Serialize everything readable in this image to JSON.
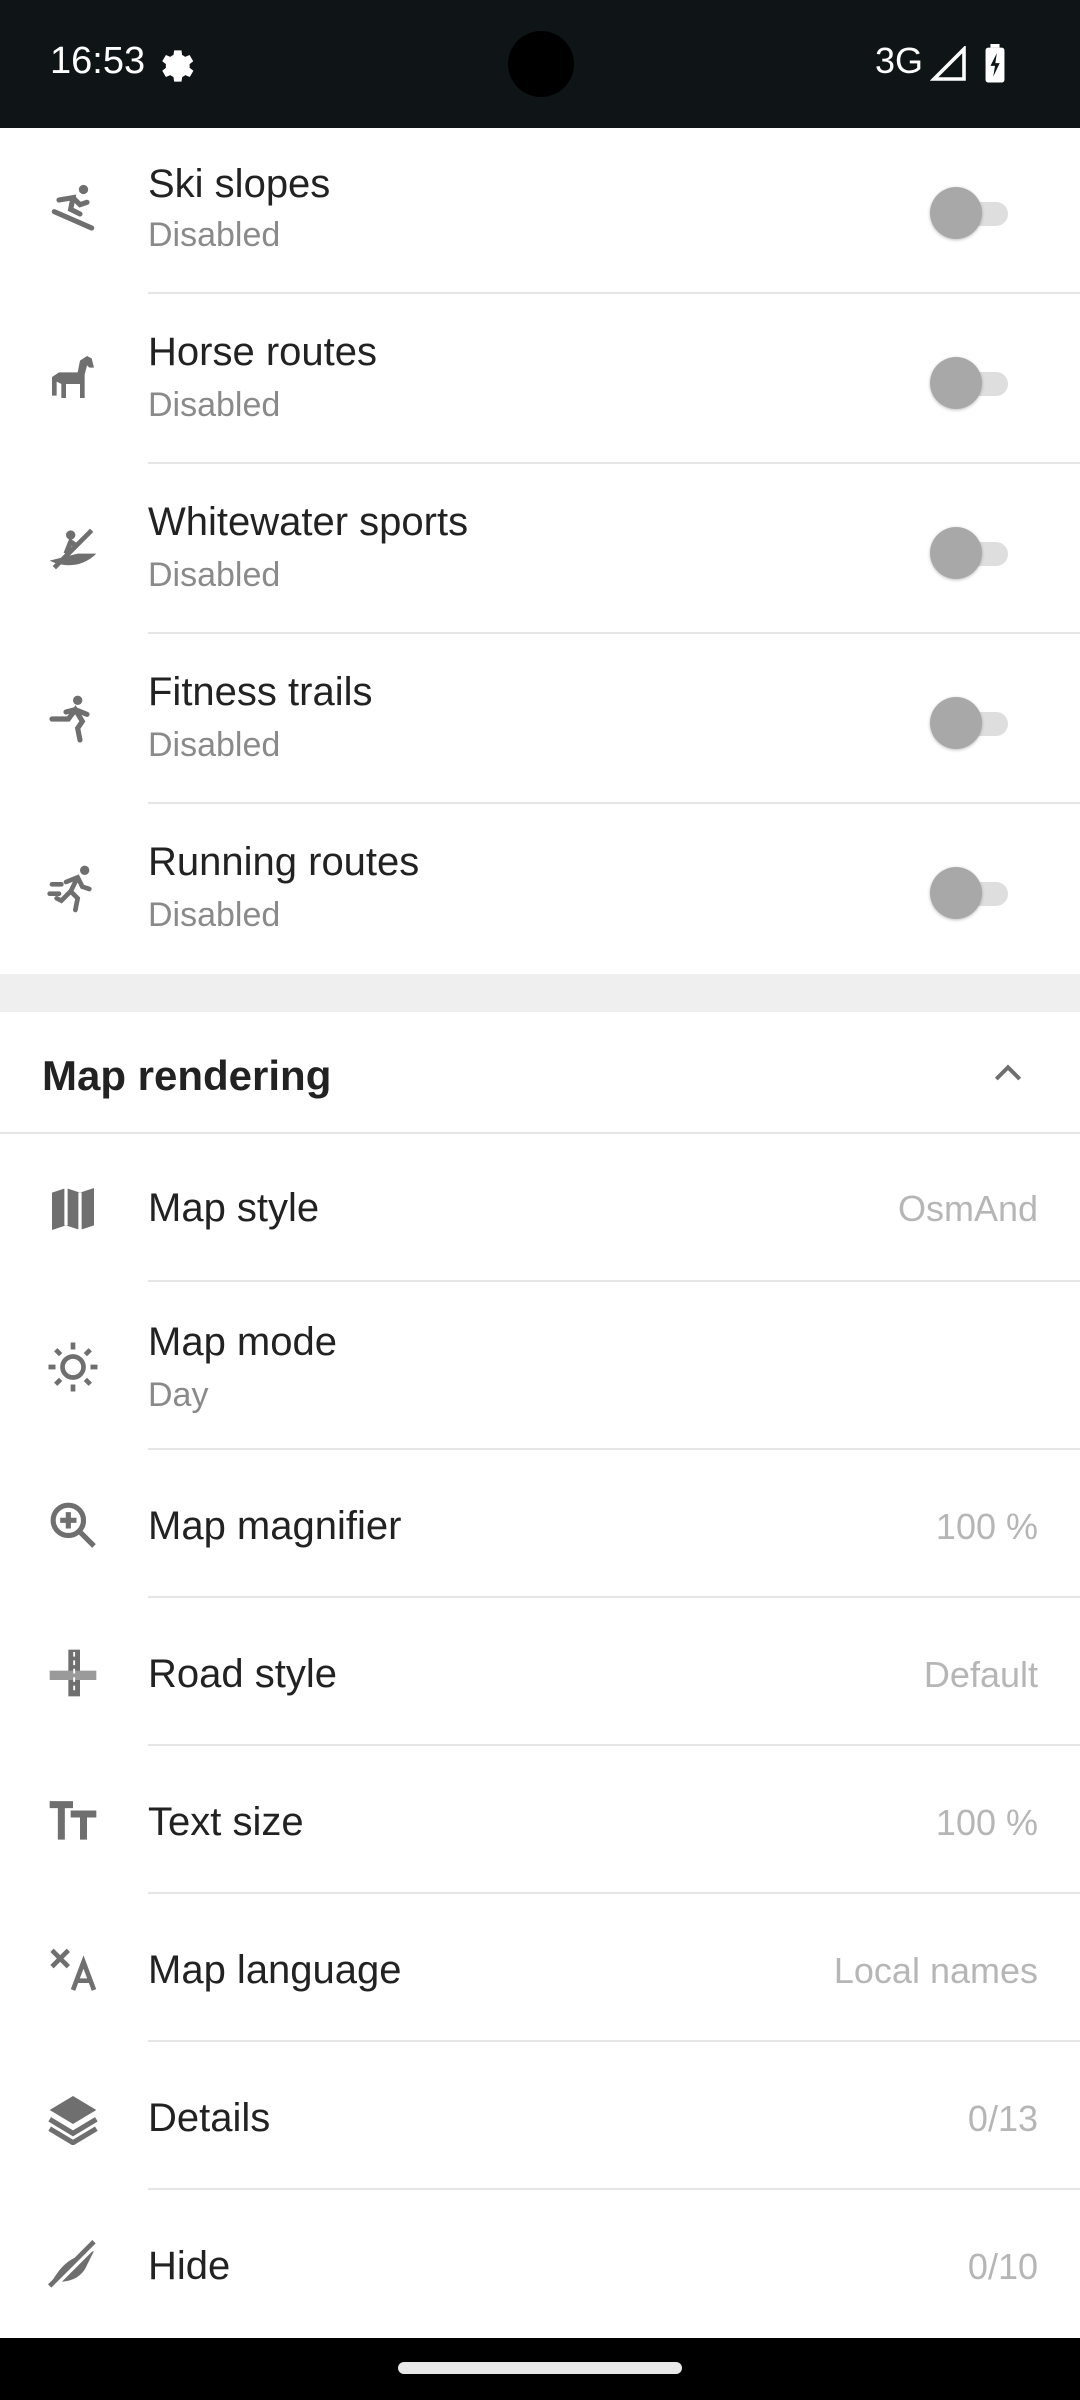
{
  "status_bar": {
    "time": "16:53",
    "network": "3G",
    "icons": [
      "gear-icon",
      "signal-icon",
      "battery-icon"
    ]
  },
  "route_types": [
    {
      "title": "Ski slopes",
      "subtitle": "Disabled",
      "icon": "skier-icon",
      "enabled": false
    },
    {
      "title": "Horse routes",
      "subtitle": "Disabled",
      "icon": "horse-icon",
      "enabled": false
    },
    {
      "title": "Whitewater sports",
      "subtitle": "Disabled",
      "icon": "kayak-icon",
      "enabled": false
    },
    {
      "title": "Fitness trails",
      "subtitle": "Disabled",
      "icon": "fitness-icon",
      "enabled": false
    },
    {
      "title": "Running routes",
      "subtitle": "Disabled",
      "icon": "running-icon",
      "enabled": false
    }
  ],
  "map_rendering": {
    "title": "Map rendering",
    "map_style": {
      "label": "Map style",
      "value": "OsmAnd"
    },
    "map_mode": {
      "label": "Map mode",
      "value": "Day"
    },
    "map_magnifier": {
      "label": "Map magnifier",
      "value": "100 %"
    },
    "road_style": {
      "label": "Road style",
      "value": "Default"
    },
    "text_size": {
      "label": "Text size",
      "value": "100 %"
    },
    "map_language": {
      "label": "Map language",
      "value": "Local names"
    },
    "details": {
      "label": "Details",
      "value": "0/13"
    },
    "hide": {
      "label": "Hide",
      "value": "0/10"
    }
  },
  "colors": {
    "status_bar_bg": "#0f1416",
    "icon_gray": "#6f6f6f",
    "value_gray": "#b6b6b6"
  }
}
